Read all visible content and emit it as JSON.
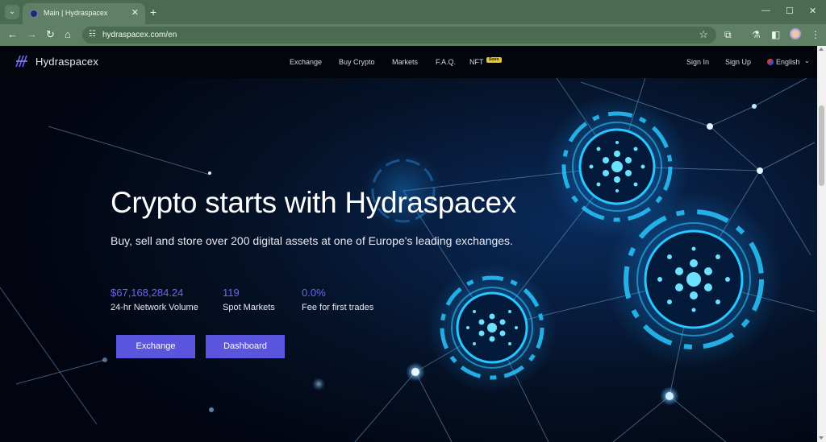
{
  "browser": {
    "tab_title": "Main | Hydraspacex",
    "url": "hydraspacex.com/en"
  },
  "header": {
    "brand": "Hydraspacex",
    "nav": [
      "Exchange",
      "Buy Crypto",
      "Markets",
      "F.A.Q.",
      "NFT"
    ],
    "nft_badge": "Soon",
    "sign_in": "Sign In",
    "sign_up": "Sign Up",
    "language": "English"
  },
  "hero": {
    "headline": "Crypto starts with Hydraspacex",
    "subtitle": "Buy, sell and store over 200 digital assets at one of Europe's leading exchanges.",
    "stats": [
      {
        "value": "$67,168,284.24",
        "label": "24-hr Network Volume"
      },
      {
        "value": "119",
        "label": "Spot Markets"
      },
      {
        "value": "0.0%",
        "label": "Fee for first trades"
      }
    ],
    "buttons": {
      "exchange": "Exchange",
      "dashboard": "Dashboard"
    }
  },
  "colors": {
    "accent": "#5a55dd",
    "stat_value": "#6d66ee",
    "page_background": "#02040f",
    "glow": "#27c7ff"
  },
  "icons": [
    "tab-search-icon",
    "close-icon",
    "plus-icon",
    "minimize-icon",
    "maximize-icon",
    "back-icon",
    "forward-icon",
    "reload-icon",
    "home-icon",
    "site-info-icon",
    "star-icon",
    "extensions-icon",
    "labs-icon",
    "sidebar-icon",
    "menu-icon",
    "globe-icon",
    "chevron-down-icon"
  ]
}
